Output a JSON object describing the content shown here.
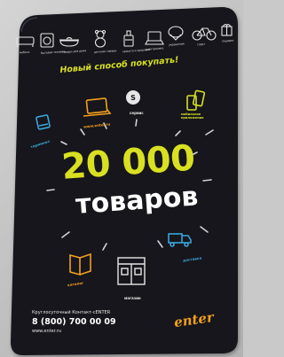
{
  "tagline": "Новый способ покупать!",
  "headline": {
    "number": "20 000",
    "word": "товаров"
  },
  "ring_labels": {
    "left": "терминал",
    "upper_left": "www.enter.ru",
    "top": "сервис",
    "upper_right": "мобильное приложение",
    "lower_right": "доставка",
    "bottom": "магазин",
    "lower_left": "каталог"
  },
  "contact": {
    "caption": "Круглосуточный Контакт-cENTER",
    "phone": "8 (800) 700 00 09",
    "site": "www.enter.ru"
  },
  "logo": {
    "text": "enter"
  },
  "top_icons": [
    {
      "name": "bed-icon",
      "label": "мебель"
    },
    {
      "name": "washer-icon",
      "label": "бытовая техника"
    },
    {
      "name": "pan-icon",
      "label": "товары для дома"
    },
    {
      "name": "teddy-icon",
      "label": "детские товары"
    },
    {
      "name": "perfume-icon",
      "label": "красота и здоровье"
    },
    {
      "name": "laptop-icon",
      "label": "электроника"
    },
    {
      "name": "ring-icon",
      "label": "украшения"
    },
    {
      "name": "bicycle-icon",
      "label": "спорт"
    },
    {
      "name": "gift-icon",
      "label": "подарки"
    }
  ],
  "colors": {
    "card": "#15181d",
    "accent_yellow": "#d9e021",
    "accent_blue": "#3aa6d8",
    "accent_orange": "#f2a01c",
    "white": "#ffffff"
  }
}
